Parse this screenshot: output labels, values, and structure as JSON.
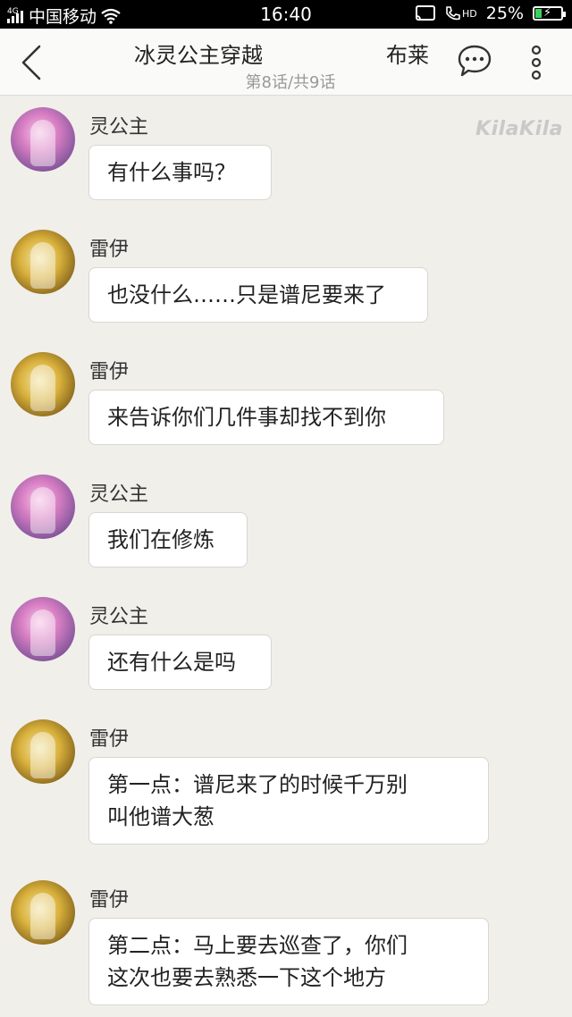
{
  "status_bar": {
    "carrier": "中国移动",
    "network": "4G",
    "time": "16:40",
    "hd": "HD",
    "battery": "25%",
    "battery_level": 0.25
  },
  "nav": {
    "title": "冰灵公主穿越",
    "title_right": "布莱",
    "subtitle": "第8话/共9话"
  },
  "watermark": "KilaKila",
  "messages": [
    {
      "speaker": "灵公主",
      "text": "有什么事吗？",
      "avatar": "ling"
    },
    {
      "speaker": "雷伊",
      "text": "也没什么……只是谱尼要来了",
      "avatar": "lei"
    },
    {
      "speaker": "雷伊",
      "text": "来告诉你们几件事却找不到你",
      "avatar": "lei"
    },
    {
      "speaker": "灵公主",
      "text": "我们在修炼",
      "avatar": "ling"
    },
    {
      "speaker": "灵公主",
      "text": "还有什么是吗",
      "avatar": "ling"
    },
    {
      "speaker": "雷伊",
      "text_line1": "第一点：谱尼来了的时候千万别",
      "text_line2": "叫他谱大葱",
      "avatar": "lei"
    },
    {
      "speaker": "雷伊",
      "text_line1": "第二点：马上要去巡查了，你们",
      "text_line2": "这次也要去熟悉一下这个地方",
      "avatar": "lei"
    }
  ],
  "colors": {
    "background": "#f1efea",
    "bubble": "#ffffff",
    "battery_fill": "#3ad35c"
  }
}
